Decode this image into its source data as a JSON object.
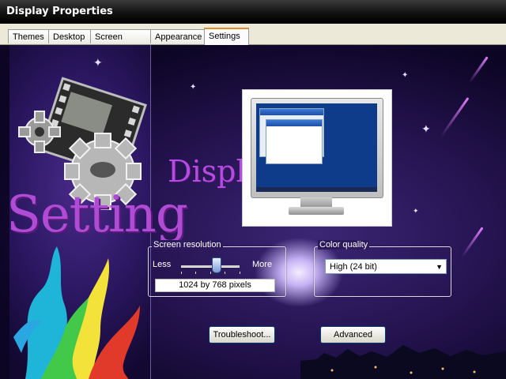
{
  "window": {
    "title": "Display Properties"
  },
  "tabs": [
    {
      "label": "Themes",
      "active": false
    },
    {
      "label": "Desktop",
      "active": false
    },
    {
      "label": "Screen Saver",
      "active": false
    },
    {
      "label": "Appearance",
      "active": false
    },
    {
      "label": "Settings",
      "active": true
    }
  ],
  "wallpaper": {
    "word_setting": "Setting",
    "word_display": "Displ"
  },
  "screen_resolution": {
    "group_label": "Screen resolution",
    "less_label": "Less",
    "more_label": "More",
    "value_text": "1024 by 768 pixels",
    "slider_level": 0.6
  },
  "color_quality": {
    "group_label": "Color quality",
    "selected": "High (24 bit)"
  },
  "buttons": {
    "troubleshoot": "Troubleshoot...",
    "advanced": "Advanced"
  },
  "colors": {
    "title_bar": "#111111",
    "accent_purple": "#b04bd6",
    "tab_highlight": "#e68b2c"
  }
}
